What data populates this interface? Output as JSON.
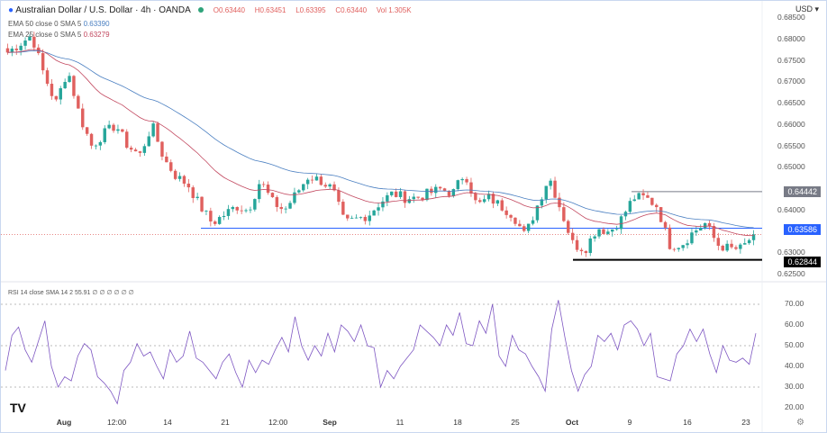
{
  "header": {
    "symbol_title": "Australian Dollar / U.S. Dollar · 4h · OANDA",
    "open": "O0.63440",
    "high": "H0.63451",
    "low": "L0.63395",
    "close": "C0.63440",
    "volume": "Vol 1.305K",
    "ema50": {
      "label": "EMA 50 close 0 SMA 5",
      "value": "0.63390"
    },
    "ema25": {
      "label": "EMA 25 close 0 SMA 5",
      "value": "0.63279"
    },
    "rsi": {
      "label": "RSI 14 close SMA 14 2",
      "value": "55.91",
      "extra": "∅ ∅ ∅ ∅ ∅ ∅"
    },
    "currency": "USD"
  },
  "levels": {
    "resistance": "0.64442",
    "current": "0.63586",
    "support": "0.62844"
  },
  "colors": {
    "up": "#26a69a",
    "down": "#e0605e",
    "ema50": "#4a7fc1",
    "ema25": "#c2485f",
    "rsi": "#7e57c2",
    "current": "#2962ff"
  },
  "chart_data": [
    {
      "type": "candlestick",
      "title": "Australian Dollar / U.S. Dollar · 4h · OANDA",
      "y_ticks": [
        "0.68500",
        "0.68000",
        "0.67500",
        "0.67000",
        "0.66500",
        "0.66000",
        "0.65500",
        "0.65000",
        "0.64000",
        "0.63000",
        "0.62500"
      ],
      "ylim": [
        0.622,
        0.686
      ],
      "x_ticks": [
        "Aug",
        "12:00",
        "14",
        "21",
        "12:00",
        "Sep",
        "11",
        "18",
        "25",
        "Oct",
        "9",
        "16",
        "23"
      ],
      "close_path": [
        0.677,
        0.679,
        0.681,
        0.672,
        0.665,
        0.673,
        0.662,
        0.655,
        0.658,
        0.66,
        0.655,
        0.653,
        0.66,
        0.652,
        0.648,
        0.646,
        0.641,
        0.637,
        0.639,
        0.641,
        0.64,
        0.647,
        0.642,
        0.64,
        0.644,
        0.648,
        0.647,
        0.645,
        0.637,
        0.638,
        0.639,
        0.642,
        0.644,
        0.643,
        0.643,
        0.644,
        0.645,
        0.644,
        0.649,
        0.641,
        0.643,
        0.641,
        0.639,
        0.634,
        0.641,
        0.648,
        0.64,
        0.632,
        0.631,
        0.636,
        0.635,
        0.638,
        0.643,
        0.643,
        0.641,
        0.632,
        0.632,
        0.635,
        0.637,
        0.632,
        0.631,
        0.631,
        0.6344
      ]
    },
    {
      "type": "line",
      "title": "RSI 14",
      "y_ticks": [
        "70.00",
        "60.00",
        "50.00",
        "40.00",
        "30.00",
        "20.00"
      ],
      "ylim": [
        15,
        75
      ],
      "values": [
        38,
        55,
        59,
        48,
        42,
        52,
        62,
        40,
        30,
        35,
        33,
        45,
        51,
        48,
        35,
        32,
        28,
        22,
        38,
        42,
        51,
        45,
        47,
        40,
        34,
        48,
        42,
        45,
        57,
        44,
        42,
        38,
        34,
        42,
        46,
        37,
        30,
        43,
        37,
        43,
        41,
        48,
        54,
        47,
        64,
        50,
        43,
        50,
        45,
        56,
        47,
        60,
        57,
        52,
        60,
        50,
        49,
        30,
        38,
        34,
        40,
        44,
        48,
        60,
        57,
        54,
        50,
        60,
        55,
        66,
        51,
        50,
        62,
        56,
        70,
        45,
        40,
        55,
        48,
        46,
        40,
        35,
        28,
        58,
        72,
        54,
        38,
        28,
        36,
        40,
        55,
        52,
        56,
        48,
        60,
        62,
        58,
        50,
        56,
        35,
        34,
        33,
        46,
        50,
        58,
        52,
        58,
        46,
        37,
        50,
        43,
        42,
        44,
        41,
        56
      ]
    }
  ]
}
